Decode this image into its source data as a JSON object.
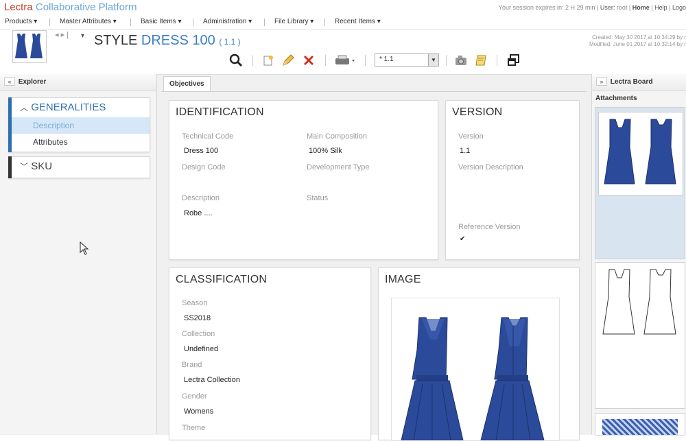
{
  "app": {
    "brand_main": "Lectra",
    "brand_sub": "Collaborative Platform",
    "session_text": "Your session expires in: 2 H 29 min",
    "user_label": "User:",
    "user_name": "root",
    "home_link": "Home",
    "help_link": "Help",
    "logout_link": "Logo"
  },
  "menu": [
    {
      "label": "Products ▾"
    },
    {
      "label": "Master Attributes ▾"
    },
    {
      "label": "Basic Items ▾"
    },
    {
      "label": "Administration ▾"
    },
    {
      "label": "File Library ▾"
    },
    {
      "label": "Recent Items ▾"
    }
  ],
  "header": {
    "style_prefix": "STYLE",
    "style_name": "DRESS 100",
    "version_badge": "( 1.1 )",
    "created": "Created: May 30 2017 at 10:34:29 by r",
    "modified": "Modified: June 01 2017 at 10:32:14 by r",
    "version_select": "* 1.1"
  },
  "explorer": {
    "title": "Explorer",
    "groups": [
      {
        "title": "GENERALITIES",
        "items": [
          {
            "label": "Description"
          },
          {
            "label": "Attributes"
          }
        ]
      },
      {
        "title": "SKU"
      }
    ]
  },
  "main": {
    "tab": "Objectives",
    "identification": {
      "title": "IDENTIFICATION",
      "technical_code_label": "Technical Code",
      "technical_code": "Dress 100",
      "main_composition_label": "Main Composition",
      "main_composition": "100% Silk",
      "design_code_label": "Design Code",
      "development_type_label": "Development Type",
      "description_label": "Description",
      "description": "Robe ....",
      "status_label": "Status"
    },
    "version": {
      "title": "VERSION",
      "version_label": "Version",
      "version": "1.1",
      "version_description_label": "Version Description",
      "reference_version_label": "Reference Version",
      "reference_version_check": "✔"
    },
    "classification": {
      "title": "CLASSIFICATION",
      "season_label": "Season",
      "season": "SS2018",
      "collection_label": "Collection",
      "collection": "Undefined",
      "brand_label": "Brand",
      "brand": "Lectra Collection",
      "gender_label": "Gender",
      "gender": "Womens",
      "theme_label": "Theme"
    },
    "image": {
      "title": "IMAGE"
    }
  },
  "board": {
    "title": "Lectra Board",
    "attachments_label": "Attachments"
  },
  "colors": {
    "brand_red": "#c0392b",
    "brand_blue": "#6aa6d8",
    "accent_blue": "#2f6fb0",
    "dress_blue": "#2c4a9a"
  }
}
